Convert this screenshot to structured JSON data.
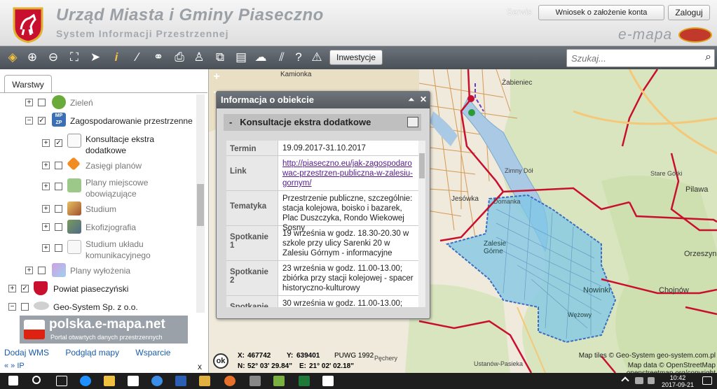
{
  "header": {
    "title": "Urząd Miasta i Gminy Piaseczno",
    "subtitle": "System Informacji Przestrzennej",
    "serwis": "Serwis",
    "request_button": "Wniosek o założenie konta",
    "login_button": "Zaloguj",
    "brand": "e-mapa"
  },
  "toolbar": {
    "investment_button": "Inwestycje",
    "search_placeholder": "Szukaj..."
  },
  "left_panel": {
    "tab": "Warstwy",
    "layers": [
      {
        "label": "Zieleń"
      },
      {
        "label": "Zagospodarowanie przestrzenne"
      },
      {
        "label": "Konsultacje ekstra dodatkowe"
      },
      {
        "label": "Zasięgi planów"
      },
      {
        "label": "Plany miejscowe obowiązujące"
      },
      {
        "label": "Studium"
      },
      {
        "label": "Ekofizjografia"
      },
      {
        "label": "Studium układu komunikacyjnego"
      },
      {
        "label": "Plany wyłożenia"
      },
      {
        "label": "Powiat piaseczyński"
      },
      {
        "label": "Geo-System Sp. z o.o."
      }
    ],
    "portal_title": "polska.e-mapa.net",
    "portal_subtitle": "Portal otwartych danych przestrzennych",
    "links": [
      "Dodaj WMS",
      "Podgląd mapy",
      "Wsparcie"
    ],
    "bottom": "« »   IP",
    "close": "x"
  },
  "popup": {
    "title": "Informacja o obiekcie",
    "section": "Konsultacje ekstra dodatkowe",
    "rows": [
      {
        "key": "Termin",
        "value": "19.09.2017-31.10.2017"
      },
      {
        "key": "Link",
        "value": "http://piaseczno.eu/jak-zagospodarowac-przestrzen-publiczna-w-zalesiu-gornym/"
      },
      {
        "key": "Tematyka",
        "value": "Przestrzenie publiczne, szczególnie: stacja kolejowa, boisko i bazarek, Plac Duszczyka, Rondo Wiekowej Sosny"
      },
      {
        "key": "Spotkanie 1",
        "value": "19 września w godz. 18.30-20.30 w szkole przy ulicy Sarenki 20 w Zalesiu Górnym - informacyjne"
      },
      {
        "key": "Spotkanie 2",
        "value": "23 września w godz. 11.00-13.00; zbiórka przy stacji kolejowej - spacer historyczno-kulturowy"
      },
      {
        "key": "Spotkanie",
        "value": "30 września w godz. 11.00-13.00;"
      }
    ]
  },
  "map": {
    "labels": [
      "Kamionka",
      "Żabieniec",
      "Zimny Dół",
      "Domanka",
      "Jesówka",
      "Zalesie Górne",
      "Nowinki",
      "Pilawa",
      "Stare Górki",
      "Orzeszyn",
      "Chojnów",
      "Wężowy",
      "Pęchery",
      "Ustanów-Pasieka",
      "Ustanów"
    ],
    "zoom_in": "+",
    "zoom_out": "−",
    "ok": "ok",
    "x_label": "X:",
    "x_value": "467742",
    "y_label": "Y:",
    "y_value": "639401",
    "crs": "PUWG 1992",
    "n_label": "N:",
    "n_value": "52° 03' 29.84\"",
    "e_label": "E:",
    "e_value": "21° 02' 02.18\"",
    "attrib_tiles": "Map tiles © Geo-System geo-system.com.pl",
    "attrib_data": "Map data © OpenStreetMap openstreetmap.org/copyright"
  },
  "taskbar": {
    "time": "10:42",
    "date": "2017-09-21"
  },
  "colors": {
    "toolbar": "#5a6067",
    "area_fill": "#7ec5e6",
    "boundary": "#c8102e",
    "link": "#1a5dab"
  }
}
